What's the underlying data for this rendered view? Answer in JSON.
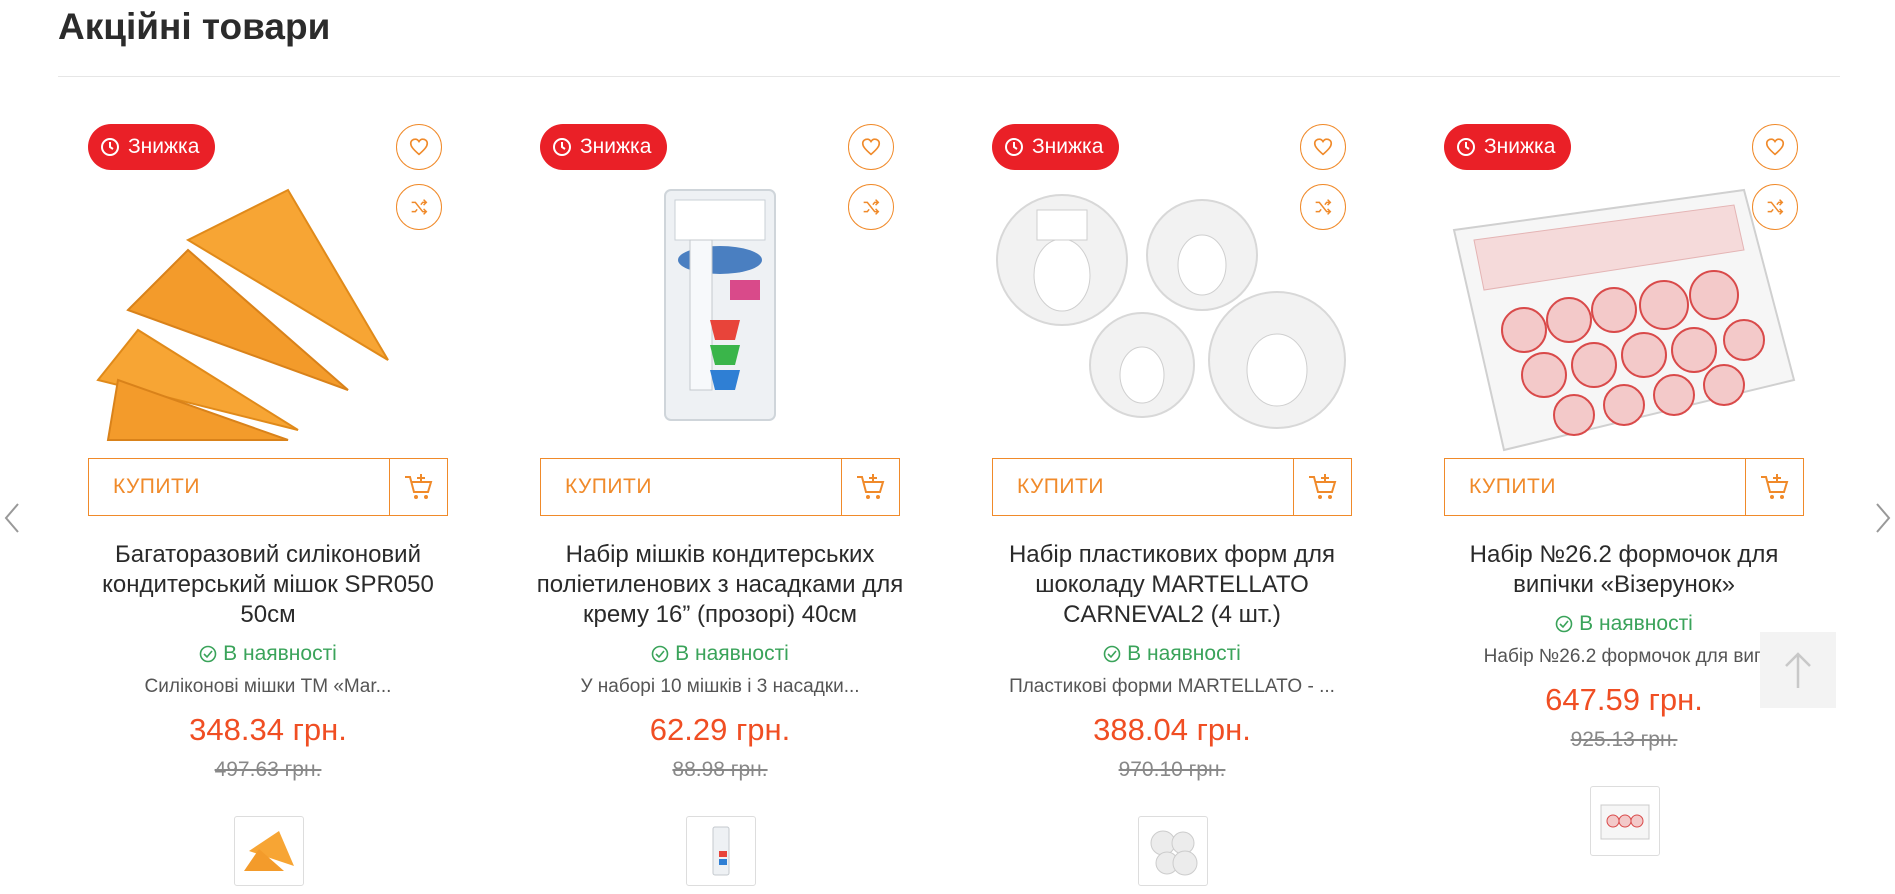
{
  "section": {
    "title": "Акційні товари"
  },
  "products": [
    {
      "badge": "Знижка",
      "buy_label": "КУПИТИ",
      "name": "Багаторазовий силіконовий кондитерський мішок SPR050 50см",
      "stock": "В наявності",
      "desc": "Силіконові мішки ТМ «Mar...",
      "price": "348.34 грн.",
      "old_price": "497.63 грн."
    },
    {
      "badge": "Знижка",
      "buy_label": "КУПИТИ",
      "name": "Набір мішків кондитерських поліетиленових з насадками для крему 16” (прозорі) 40см",
      "stock": "В наявності",
      "desc": "У наборі 10 мішків і 3 насадки...",
      "price": "62.29 грн.",
      "old_price": "88.98 грн."
    },
    {
      "badge": "Знижка",
      "buy_label": "КУПИТИ",
      "name": "Набір пластикових форм для шоколаду MARTELLATO CARNEVAL2 (4 шт.)",
      "stock": "В наявності",
      "desc": "Пластикові форми MARTELLATO - ...",
      "price": "388.04 грн.",
      "old_price": "970.10 грн."
    },
    {
      "badge": "Знижка",
      "buy_label": "КУПИТИ",
      "name": "Набір №26.2 формочок для випічки «Візерунок»",
      "stock": "В наявності",
      "desc": "Набір №26.2 формочок для вип",
      "price": "647.59 грн.",
      "old_price": "925.13 грн."
    }
  ],
  "colors": {
    "accent": "#f08a2a",
    "badge": "#ea2027",
    "price": "#f04e23",
    "stock": "#3aa35a"
  }
}
